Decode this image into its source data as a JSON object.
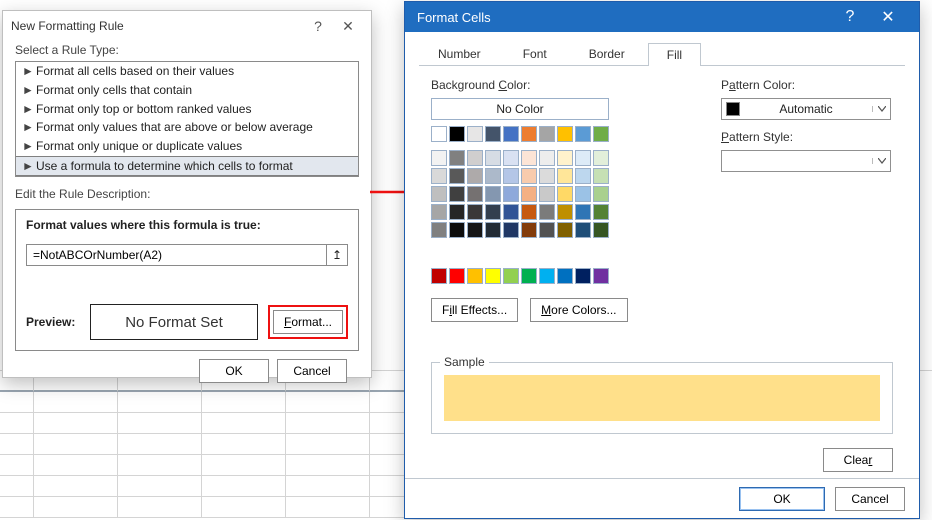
{
  "dlg1": {
    "title": "New Formatting Rule",
    "help_icon": "?",
    "close_icon": "✕",
    "select_rule_label": "Select a Rule Type:",
    "rules": [
      "Format all cells based on their values",
      "Format only cells that contain",
      "Format only top or bottom ranked values",
      "Format only values that are above or below average",
      "Format only unique or duplicate values",
      "Use a formula to determine which cells to format"
    ],
    "edit_label": "Edit the Rule Description:",
    "formula_label": "Format values where this formula is true:",
    "formula_value": "=NotABCOrNumber(A2)",
    "refpicker_icon": "↥",
    "preview_label": "Preview:",
    "preview_text": "No Format Set",
    "format_btn": "Format...",
    "ok": "OK",
    "cancel": "Cancel"
  },
  "dlg2": {
    "title": "Format Cells",
    "help_icon": "?",
    "close_icon": "✕",
    "tabs": [
      "Number",
      "Font",
      "Border",
      "Fill"
    ],
    "active_tab": 3,
    "bgcolor_label": "Background Color:",
    "no_color": "No Color",
    "fill_effects": "Fill Effects...",
    "more_colors": "More Colors...",
    "pattern_color_label": "Pattern Color:",
    "pattern_color_value": "Automatic",
    "pattern_style_label": "Pattern Style:",
    "sample_label": "Sample",
    "clear": "Clear",
    "ok": "OK",
    "cancel": "Cancel",
    "theme_row0": [
      "#ffffff",
      "#000000",
      "#e7e6e6",
      "#44546a",
      "#4472c4",
      "#ed7d31",
      "#a5a5a5",
      "#ffc000",
      "#5b9bd5",
      "#70ad47"
    ],
    "theme_shades": [
      [
        "#f2f2f2",
        "#808080",
        "#d0cece",
        "#d6dce4",
        "#d9e1f2",
        "#fce4d6",
        "#ededed",
        "#fff2cc",
        "#ddebf7",
        "#e2efda"
      ],
      [
        "#d9d9d9",
        "#595959",
        "#aeaaaa",
        "#acb9ca",
        "#b4c6e7",
        "#f8cbad",
        "#dbdbdb",
        "#ffe699",
        "#bdd7ee",
        "#c6e0b4"
      ],
      [
        "#bfbfbf",
        "#404040",
        "#757171",
        "#8497b0",
        "#8ea9db",
        "#f4b084",
        "#c9c9c9",
        "#ffd966",
        "#9bc2e6",
        "#a9d08e"
      ],
      [
        "#a6a6a6",
        "#262626",
        "#3a3838",
        "#333f4f",
        "#305496",
        "#c65911",
        "#7b7b7b",
        "#bf8f00",
        "#2f75b5",
        "#548235"
      ],
      [
        "#808080",
        "#0d0d0d",
        "#161616",
        "#222b35",
        "#203764",
        "#833c0c",
        "#525252",
        "#806000",
        "#1f4e78",
        "#375623"
      ]
    ],
    "standard": [
      "#c00000",
      "#ff0000",
      "#ffc000",
      "#ffff00",
      "#92d050",
      "#00b050",
      "#00b0f0",
      "#0070c0",
      "#002060",
      "#7030a0"
    ],
    "sample_color": "#ffe08a"
  }
}
